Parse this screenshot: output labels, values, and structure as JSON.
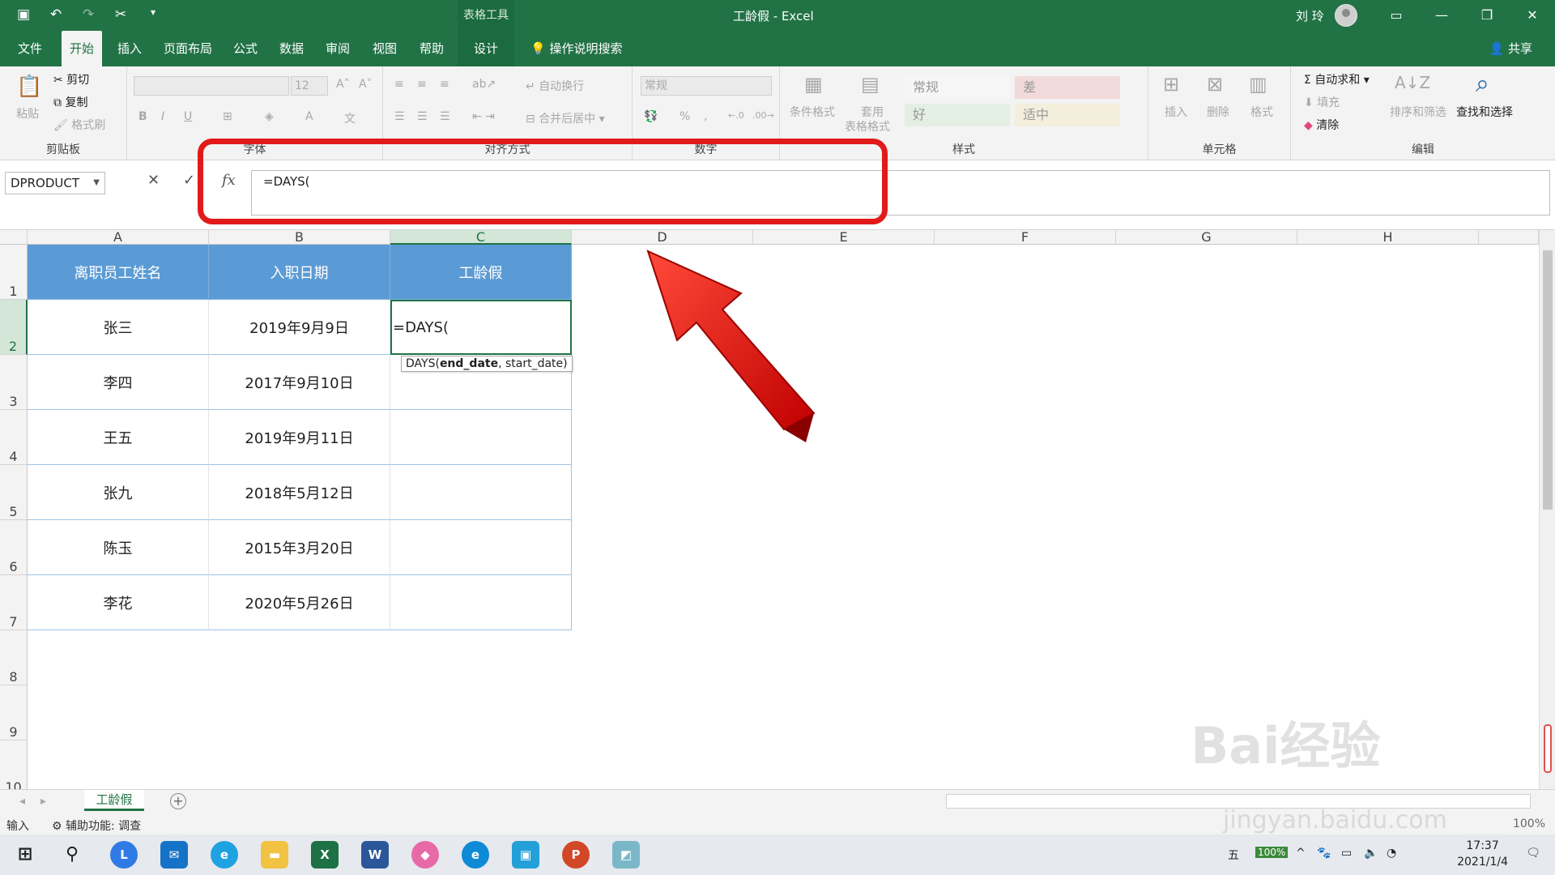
{
  "window": {
    "context_tab": "表格工具",
    "title": "工龄假 - Excel",
    "user": "刘 玲",
    "share": "共享"
  },
  "ribbon_tabs": [
    "文件",
    "开始",
    "插入",
    "页面布局",
    "公式",
    "数据",
    "审阅",
    "视图",
    "帮助",
    "设计"
  ],
  "search_hint": "操作说明搜索",
  "ribbon": {
    "clipboard": {
      "paste": "粘贴",
      "cut": "剪切",
      "copy": "复制",
      "format_painter": "格式刷",
      "label": "剪贴板"
    },
    "font": {
      "size": "12",
      "label": "字体"
    },
    "alignment": {
      "wrap": "自动换行",
      "merge": "合并后居中",
      "label": "对齐方式"
    },
    "number": {
      "format": "常规",
      "label": "数字"
    },
    "styles": {
      "cond": "条件格式",
      "table": "套用",
      "table2": "表格格式",
      "normal": "常规",
      "bad": "差",
      "good": "好",
      "neutral": "适中",
      "label": "样式"
    },
    "cells": {
      "insert": "插入",
      "delete": "删除",
      "format": "格式",
      "label": "单元格"
    },
    "editing": {
      "autosum": "自动求和",
      "fill": "填充",
      "clear": "清除",
      "sort": "排序和筛选",
      "find": "查找和选择",
      "label": "编辑"
    }
  },
  "formula_bar": {
    "name_box": "DPRODUCT",
    "fx": "fx",
    "formula": "=DAYS("
  },
  "columns": [
    "A",
    "B",
    "C",
    "D",
    "E",
    "F",
    "G",
    "H"
  ],
  "rows": [
    "1",
    "2",
    "3",
    "4",
    "5",
    "6",
    "7",
    "8",
    "9",
    "10"
  ],
  "table": {
    "headers": [
      "离职员工姓名",
      "入职日期",
      "工龄假"
    ],
    "rows": [
      [
        "张三",
        "2019年9月9日",
        "=DAYS("
      ],
      [
        "李四",
        "2017年9月10日",
        ""
      ],
      [
        "王五",
        "2019年9月11日",
        ""
      ],
      [
        "张九",
        "2018年5月12日",
        ""
      ],
      [
        "陈玉",
        "2015年3月20日",
        ""
      ],
      [
        "李花",
        "2020年5月26日",
        ""
      ]
    ]
  },
  "tooltip": {
    "prefix": "DAYS(",
    "bold": "end_date",
    "rest": ", start_date)"
  },
  "sheet_tab": "工龄假",
  "status": {
    "mode": "输入",
    "accessibility": "辅助功能: 调查",
    "zoom": "100%"
  },
  "taskbar": {
    "ime": "五",
    "battery": "100%",
    "time": "17:37",
    "date": "2021/1/4"
  },
  "colors": {
    "excel_green": "#217346",
    "header_blue": "#5b9bd5",
    "highlight_red": "#e21a1a"
  },
  "watermark": {
    "brand": "Bai经验",
    "url": "jingyan.baidu.com"
  }
}
